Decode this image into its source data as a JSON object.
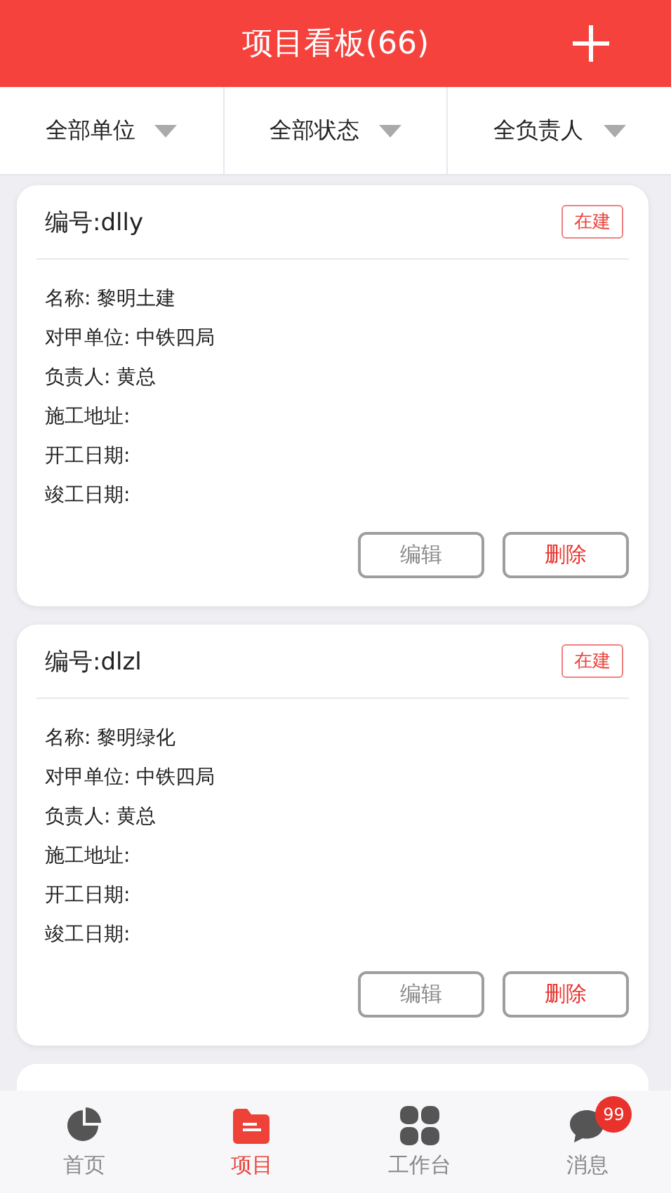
{
  "header": {
    "title": "项目看板(66)"
  },
  "filters": [
    {
      "label": "全部单位"
    },
    {
      "label": "全部状态"
    },
    {
      "label": "全负责人"
    }
  ],
  "projects": [
    {
      "code": "编号:dlly",
      "status": "在建",
      "fields": [
        "名称: 黎明土建",
        "对甲单位: 中铁四局",
        "负责人:  黄总",
        "施工地址:",
        "开工日期:",
        "竣工日期:"
      ],
      "buttons": [
        {
          "label": "编辑",
          "kind": "edit"
        },
        {
          "label": "删除",
          "kind": "delete"
        }
      ]
    },
    {
      "code": "编号:dlzl",
      "status": "在建",
      "fields": [
        "名称: 黎明绿化",
        "对甲单位: 中铁四局",
        "负责人:  黄总",
        "施工地址:",
        "开工日期:",
        "竣工日期:"
      ],
      "buttons": [
        {
          "label": "编辑",
          "kind": "edit"
        },
        {
          "label": "删除",
          "kind": "delete"
        }
      ]
    }
  ],
  "more_below": true,
  "tabs": [
    {
      "label": "首页",
      "kind": "pie",
      "selected": false
    },
    {
      "label": "项目",
      "kind": "folder",
      "selected": true
    },
    {
      "label": "工作台",
      "kind": "grid",
      "selected": false
    },
    {
      "label": "消息",
      "kind": "chat",
      "selected": false,
      "badge": "99"
    }
  ]
}
